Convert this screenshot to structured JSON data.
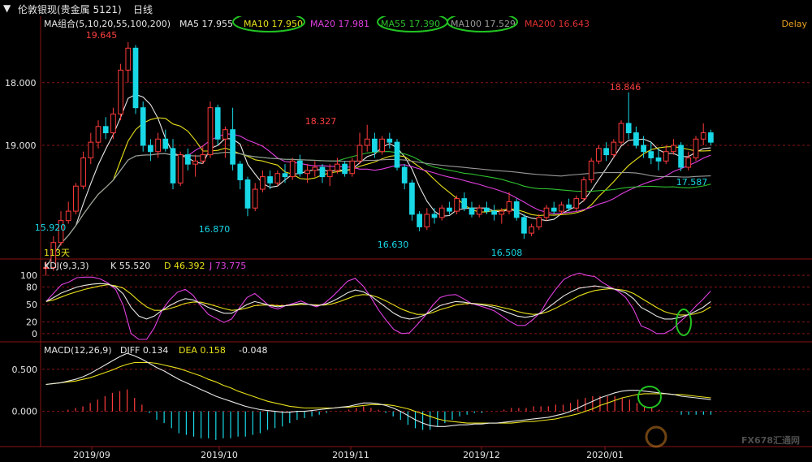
{
  "window": {
    "title": "伦敦银现(贵金属 5121)",
    "period": "日线",
    "delay_badge": "Delay"
  },
  "watermark": "FX678汇通网",
  "colors": {
    "up": "#ff3b3b",
    "down": "#18d8e6",
    "ma5": "#e8e8e8",
    "ma10": "#e8e11a",
    "ma20": "#e040e0",
    "ma55": "#2fbf2f",
    "ma100": "#9a9a9a",
    "ma200": "#e03030",
    "grid": "#8a1515",
    "highlight_circle": "#22c322",
    "axis_text": "#e6e6e6"
  },
  "main_panel": {
    "legend": {
      "name": "MA组合(5,10,20,55,100,200)",
      "items": [
        {
          "key": "ma5",
          "text": "MA5 17.955"
        },
        {
          "key": "ma10",
          "text": "MA10 17.950"
        },
        {
          "key": "ma20",
          "text": "MA20 17.981"
        },
        {
          "key": "ma55",
          "text": "MA55 17.390"
        },
        {
          "key": "ma100",
          "text": "MA100 17.529"
        },
        {
          "key": "ma200",
          "text": "MA200 16.643"
        }
      ]
    },
    "y_ticks": [
      "19.000",
      "18.000"
    ],
    "price_annotations": [
      {
        "text": "19.645",
        "color": "#ff4040"
      },
      {
        "text": "18.327",
        "color": "#ff4040"
      },
      {
        "text": "18.846",
        "color": "#ff4040"
      },
      {
        "text": "16.870",
        "color": "#18d8e6"
      },
      {
        "text": "16.630",
        "color": "#18d8e6"
      },
      {
        "text": "16.508",
        "color": "#18d8e6"
      },
      {
        "text": "17.587",
        "color": "#18d8e6"
      },
      {
        "text": "15.920",
        "color": "#18d8e6"
      }
    ],
    "days_label": "113天"
  },
  "kdj_panel": {
    "legend": {
      "name": "KDJ(9,3,3)",
      "items": [
        {
          "key": "k",
          "text": "K 55.520",
          "color": "#e8e8e8"
        },
        {
          "key": "d",
          "text": "D 46.392",
          "color": "#e8e11a"
        },
        {
          "key": "j",
          "text": "J 73.775",
          "color": "#e040e0"
        }
      ]
    },
    "y_ticks": [
      "100",
      "80",
      "50",
      "20",
      "0"
    ]
  },
  "macd_panel": {
    "legend": {
      "name": "MACD(12,26,9)",
      "items": [
        {
          "key": "diff",
          "text": "DIFF 0.134",
          "color": "#e8e8e8"
        },
        {
          "key": "dea",
          "text": "DEA 0.158",
          "color": "#e8e11a"
        },
        {
          "key": "macd",
          "text": "-0.048",
          "color": "#e8e8e8"
        }
      ]
    },
    "y_ticks": [
      "0.500",
      "0.000"
    ]
  },
  "x_axis": {
    "ticks": [
      "2019/09",
      "2019/10",
      "2019/11",
      "2019/12",
      "2020/01"
    ]
  },
  "chart_data": {
    "type": "candlestick",
    "instrument": "伦敦银现(贵金属 5121)",
    "period": "日线",
    "x_ticks": [
      "2019/09",
      "2019/10",
      "2019/11",
      "2019/12",
      "2020/01"
    ],
    "price_ylim": [
      16.2,
      19.8
    ],
    "y_ticks": [
      18.0,
      19.0
    ],
    "kdj_ylim": [
      -10,
      110
    ],
    "kdj_ticks": [
      0,
      20,
      50,
      80,
      100
    ],
    "macd_ylim": [
      -0.38,
      0.72
    ],
    "macd_ticks": [
      0.0,
      0.5
    ],
    "candles": [
      [
        16.05,
        16.15,
        15.92,
        16.05
      ],
      [
        16.05,
        16.55,
        16.0,
        16.45
      ],
      [
        16.45,
        16.95,
        16.4,
        16.8
      ],
      [
        16.8,
        17.1,
        16.75,
        16.95
      ],
      [
        16.95,
        17.4,
        16.9,
        17.35
      ],
      [
        17.35,
        17.9,
        17.3,
        17.8
      ],
      [
        17.8,
        18.2,
        17.7,
        18.05
      ],
      [
        18.05,
        18.4,
        17.95,
        18.3
      ],
      [
        18.3,
        18.45,
        18.1,
        18.2
      ],
      [
        18.2,
        18.6,
        18.1,
        18.5
      ],
      [
        18.5,
        19.3,
        18.4,
        19.2
      ],
      [
        19.2,
        19.645,
        19.0,
        19.55
      ],
      [
        19.55,
        19.6,
        18.5,
        18.6
      ],
      [
        18.6,
        18.7,
        17.9,
        18.0
      ],
      [
        18.0,
        18.1,
        17.75,
        17.9
      ],
      [
        17.9,
        18.2,
        17.8,
        18.1
      ],
      [
        18.1,
        18.25,
        17.9,
        17.95
      ],
      [
        17.95,
        18.1,
        17.3,
        17.4
      ],
      [
        17.4,
        17.9,
        17.35,
        17.85
      ],
      [
        17.85,
        17.95,
        17.6,
        17.7
      ],
      [
        17.7,
        17.85,
        17.5,
        17.75
      ],
      [
        17.75,
        18.0,
        17.7,
        17.85
      ],
      [
        17.85,
        18.7,
        17.8,
        18.6
      ],
      [
        18.6,
        18.65,
        18.0,
        18.1
      ],
      [
        18.1,
        18.3,
        17.8,
        18.25
      ],
      [
        18.25,
        18.6,
        17.6,
        17.7
      ],
      [
        17.7,
        17.75,
        17.3,
        17.45
      ],
      [
        17.45,
        17.5,
        16.87,
        17.0
      ],
      [
        17.0,
        17.4,
        16.95,
        17.3
      ],
      [
        17.3,
        17.6,
        17.25,
        17.5
      ],
      [
        17.5,
        17.6,
        17.3,
        17.4
      ],
      [
        17.4,
        17.6,
        17.35,
        17.55
      ],
      [
        17.55,
        17.7,
        17.4,
        17.5
      ],
      [
        17.5,
        17.8,
        17.45,
        17.75
      ],
      [
        17.75,
        17.85,
        17.5,
        17.55
      ],
      [
        17.55,
        17.7,
        17.4,
        17.6
      ],
      [
        17.6,
        17.75,
        17.5,
        17.65
      ],
      [
        17.65,
        17.7,
        17.4,
        17.5
      ],
      [
        17.5,
        17.7,
        17.35,
        17.6
      ],
      [
        17.6,
        17.8,
        17.55,
        17.7
      ],
      [
        17.7,
        17.75,
        17.5,
        17.55
      ],
      [
        17.55,
        17.8,
        17.5,
        17.75
      ],
      [
        17.75,
        18.2,
        17.7,
        18.0
      ],
      [
        18.0,
        18.327,
        17.9,
        18.1
      ],
      [
        18.1,
        18.2,
        17.8,
        17.9
      ],
      [
        17.9,
        18.15,
        17.85,
        18.1
      ],
      [
        18.1,
        18.2,
        17.95,
        18.05
      ],
      [
        18.05,
        18.1,
        17.6,
        17.65
      ],
      [
        17.65,
        17.7,
        17.3,
        17.4
      ],
      [
        17.4,
        17.45,
        16.8,
        16.9
      ],
      [
        16.9,
        16.95,
        16.63,
        16.7
      ],
      [
        16.7,
        17.0,
        16.65,
        16.9
      ],
      [
        16.9,
        17.0,
        16.75,
        16.85
      ],
      [
        16.85,
        17.05,
        16.8,
        17.0
      ],
      [
        17.0,
        17.1,
        16.9,
        16.95
      ],
      [
        16.95,
        17.2,
        16.9,
        17.15
      ],
      [
        17.15,
        17.25,
        16.95,
        17.0
      ],
      [
        17.0,
        17.1,
        16.85,
        16.9
      ],
      [
        16.9,
        17.05,
        16.85,
        17.0
      ],
      [
        17.0,
        17.1,
        16.9,
        16.95
      ],
      [
        16.95,
        17.05,
        16.8,
        16.9
      ],
      [
        16.9,
        17.0,
        16.75,
        16.95
      ],
      [
        16.95,
        17.25,
        16.9,
        17.1
      ],
      [
        17.1,
        17.15,
        16.8,
        16.85
      ],
      [
        16.85,
        16.9,
        16.508,
        16.6
      ],
      [
        16.6,
        16.75,
        16.55,
        16.7
      ],
      [
        16.7,
        16.9,
        16.65,
        16.85
      ],
      [
        16.85,
        17.05,
        16.8,
        17.0
      ],
      [
        17.0,
        17.1,
        16.9,
        16.95
      ],
      [
        16.95,
        17.1,
        16.9,
        17.05
      ],
      [
        17.05,
        17.15,
        16.95,
        17.0
      ],
      [
        17.0,
        17.2,
        16.95,
        17.15
      ],
      [
        17.15,
        17.5,
        17.1,
        17.45
      ],
      [
        17.45,
        17.8,
        17.4,
        17.75
      ],
      [
        17.75,
        18.0,
        17.7,
        17.95
      ],
      [
        17.95,
        18.05,
        17.75,
        17.85
      ],
      [
        17.85,
        18.1,
        17.8,
        18.05
      ],
      [
        18.05,
        18.4,
        18.0,
        18.35
      ],
      [
        18.35,
        18.846,
        18.1,
        18.2
      ],
      [
        18.2,
        18.3,
        17.95,
        18.0
      ],
      [
        18.0,
        18.15,
        17.8,
        17.9
      ],
      [
        17.9,
        18.05,
        17.7,
        17.8
      ],
      [
        17.8,
        17.95,
        17.6,
        17.75
      ],
      [
        17.75,
        18.0,
        17.7,
        17.9
      ],
      [
        17.9,
        18.1,
        17.85,
        18.0
      ],
      [
        18.0,
        18.05,
        17.587,
        17.65
      ],
      [
        17.65,
        17.9,
        17.6,
        17.8
      ],
      [
        17.8,
        18.15,
        17.75,
        18.1
      ],
      [
        18.1,
        18.35,
        18.0,
        18.2
      ],
      [
        18.2,
        18.25,
        18.0,
        18.05
      ]
    ],
    "kdj": {
      "k": [
        55,
        62,
        70,
        75,
        80,
        83,
        85,
        86,
        85,
        80,
        68,
        45,
        30,
        25,
        30,
        40,
        48,
        55,
        60,
        58,
        52,
        45,
        40,
        35,
        35,
        42,
        50,
        55,
        52,
        48,
        46,
        48,
        50,
        52,
        50,
        48,
        50,
        55,
        62,
        70,
        75,
        72,
        65,
        55,
        45,
        35,
        28,
        25,
        27,
        32,
        40,
        48,
        52,
        55,
        54,
        52,
        50,
        48,
        45,
        40,
        35,
        30,
        28,
        30,
        35,
        45,
        55,
        65,
        72,
        78,
        80,
        82,
        80,
        78,
        75,
        70,
        60,
        45,
        38,
        30,
        25,
        25,
        28,
        32,
        38,
        45,
        55
      ],
      "d": [
        55,
        58,
        63,
        68,
        72,
        76,
        79,
        82,
        84,
        82,
        78,
        68,
        56,
        46,
        40,
        40,
        43,
        47,
        52,
        54,
        54,
        51,
        47,
        43,
        40,
        41,
        44,
        48,
        49,
        49,
        48,
        48,
        49,
        50,
        50,
        49,
        49,
        51,
        55,
        60,
        65,
        67,
        66,
        62,
        56,
        49,
        42,
        37,
        33,
        33,
        36,
        41,
        45,
        49,
        51,
        52,
        51,
        50,
        48,
        45,
        42,
        38,
        35,
        33,
        34,
        38,
        44,
        51,
        58,
        65,
        70,
        74,
        76,
        77,
        76,
        74,
        69,
        61,
        53,
        45,
        38,
        34,
        32,
        32,
        34,
        38,
        46
      ],
      "j": [
        55,
        70,
        84,
        89,
        96,
        97,
        97,
        94,
        87,
        76,
        48,
        0,
        -10,
        -10,
        10,
        40,
        58,
        71,
        76,
        66,
        48,
        33,
        26,
        19,
        25,
        44,
        62,
        69,
        58,
        46,
        42,
        48,
        52,
        56,
        50,
        46,
        52,
        63,
        76,
        90,
        95,
        82,
        63,
        41,
        23,
        7,
        0,
        1,
        15,
        30,
        48,
        62,
        66,
        67,
        60,
        52,
        48,
        44,
        39,
        30,
        21,
        14,
        14,
        24,
        37,
        59,
        77,
        93,
        100,
        104,
        100,
        98,
        88,
        80,
        73,
        62,
        42,
        13,
        8,
        0,
        0,
        7,
        20,
        32,
        46,
        59,
        73
      ]
    },
    "macd": {
      "diff": [
        0.32,
        0.33,
        0.34,
        0.36,
        0.38,
        0.41,
        0.45,
        0.5,
        0.55,
        0.6,
        0.65,
        0.69,
        0.66,
        0.62,
        0.57,
        0.52,
        0.48,
        0.43,
        0.38,
        0.34,
        0.3,
        0.26,
        0.22,
        0.18,
        0.15,
        0.12,
        0.09,
        0.06,
        0.04,
        0.02,
        0.01,
        0.0,
        -0.01,
        -0.01,
        0.0,
        0.0,
        0.01,
        0.02,
        0.03,
        0.04,
        0.05,
        0.06,
        0.08,
        0.1,
        0.1,
        0.09,
        0.07,
        0.04,
        0.0,
        -0.05,
        -0.1,
        -0.14,
        -0.17,
        -0.18,
        -0.18,
        -0.17,
        -0.16,
        -0.16,
        -0.15,
        -0.15,
        -0.14,
        -0.14,
        -0.13,
        -0.12,
        -0.11,
        -0.1,
        -0.09,
        -0.08,
        -0.07,
        -0.05,
        -0.03,
        0.0,
        0.04,
        0.08,
        0.12,
        0.16,
        0.19,
        0.22,
        0.24,
        0.25,
        0.25,
        0.24,
        0.23,
        0.22,
        0.21,
        0.2,
        0.18,
        0.17,
        0.16,
        0.15,
        0.14
      ],
      "dea": [
        0.32,
        0.33,
        0.34,
        0.35,
        0.36,
        0.38,
        0.4,
        0.43,
        0.46,
        0.49,
        0.53,
        0.56,
        0.58,
        0.58,
        0.58,
        0.57,
        0.55,
        0.53,
        0.51,
        0.48,
        0.45,
        0.42,
        0.38,
        0.35,
        0.31,
        0.28,
        0.24,
        0.21,
        0.18,
        0.15,
        0.12,
        0.1,
        0.08,
        0.06,
        0.05,
        0.04,
        0.04,
        0.04,
        0.04,
        0.04,
        0.05,
        0.05,
        0.06,
        0.07,
        0.08,
        0.08,
        0.08,
        0.07,
        0.05,
        0.03,
        0.0,
        -0.03,
        -0.06,
        -0.09,
        -0.11,
        -0.12,
        -0.13,
        -0.14,
        -0.14,
        -0.14,
        -0.14,
        -0.14,
        -0.14,
        -0.14,
        -0.13,
        -0.12,
        -0.12,
        -0.11,
        -0.1,
        -0.09,
        -0.07,
        -0.05,
        -0.03,
        0.0,
        0.03,
        0.07,
        0.1,
        0.13,
        0.16,
        0.18,
        0.2,
        0.21,
        0.21,
        0.21,
        0.21,
        0.2,
        0.2,
        0.19,
        0.18,
        0.17,
        0.16
      ]
    }
  }
}
